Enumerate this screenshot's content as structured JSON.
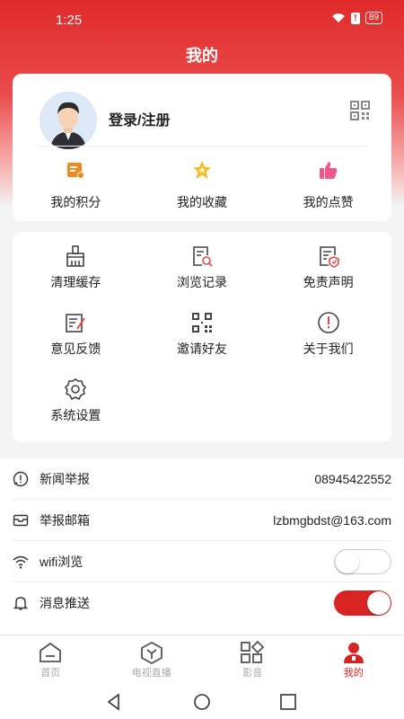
{
  "status": {
    "time": "1:25",
    "battery": "89"
  },
  "header": {
    "title": "我的"
  },
  "profile": {
    "login_label": "登录/注册",
    "stats": [
      {
        "label": "我的积分",
        "icon": "points-icon"
      },
      {
        "label": "我的收藏",
        "icon": "star-icon"
      },
      {
        "label": "我的点赞",
        "icon": "thumbs-up-icon"
      }
    ]
  },
  "menu": {
    "items": [
      {
        "label": "清理缓存",
        "icon": "broom-icon"
      },
      {
        "label": "浏览记录",
        "icon": "history-icon"
      },
      {
        "label": "免责声明",
        "icon": "disclaimer-icon"
      },
      {
        "label": "意见反馈",
        "icon": "feedback-icon"
      },
      {
        "label": "邀请好友",
        "icon": "invite-icon"
      },
      {
        "label": "关于我们",
        "icon": "info-icon"
      },
      {
        "label": "系统设置",
        "icon": "gear-icon"
      }
    ]
  },
  "settings": {
    "news_report": {
      "label": "新闻举报",
      "value": "08945422552"
    },
    "report_email": {
      "label": "举报邮箱",
      "value": "lzbmgbdst@163.com"
    },
    "wifi_browse": {
      "label": "wifi浏览",
      "enabled": false
    },
    "push_notify": {
      "label": "消息推送",
      "enabled": true
    }
  },
  "tabs": [
    {
      "label": "首页",
      "icon": "home-icon"
    },
    {
      "label": "电视直播",
      "icon": "tv-icon"
    },
    {
      "label": "影音",
      "icon": "media-icon"
    },
    {
      "label": "我的",
      "icon": "user-icon",
      "active": true
    }
  ],
  "colors": {
    "brand": "#d82323",
    "stat_orange": "#f08a1c",
    "stat_pink": "#f0578e"
  }
}
